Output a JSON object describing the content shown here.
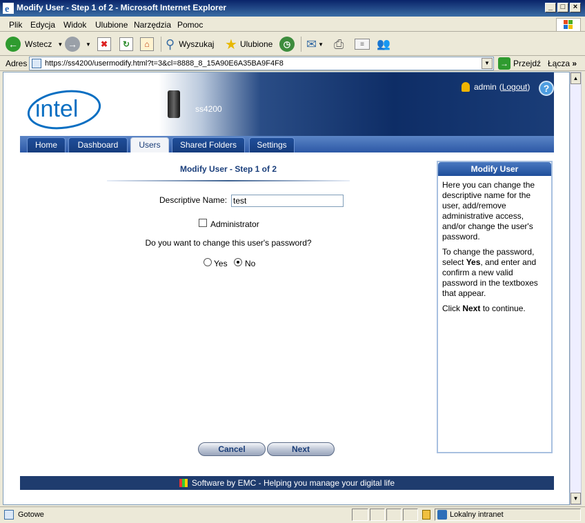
{
  "window": {
    "title": "Modify User - Step 1 of 2 - Microsoft Internet Explorer"
  },
  "menu": {
    "items": [
      "Plik",
      "Edycja",
      "Widok",
      "Ulubione",
      "Narzędzia",
      "Pomoc"
    ]
  },
  "toolbar": {
    "back": "Wstecz",
    "search": "Wyszukaj",
    "favorites": "Ulubione"
  },
  "address": {
    "label": "Adres",
    "url": "https://ss4200/usermodify.html?t=3&cl=8888_8_15A90E6A35BA9F4F8",
    "go": "Przejdź",
    "links": "Łącza"
  },
  "header": {
    "logo_text": "intel",
    "device": "ss4200",
    "user": "admin",
    "logout": "Logout"
  },
  "nav": {
    "tabs": [
      "Home",
      "Dashboard",
      "Users",
      "Shared Folders",
      "Settings"
    ],
    "active": "Users"
  },
  "form": {
    "title": "Modify User - Step 1 of 2",
    "name_label": "Descriptive Name:",
    "name_value": "test",
    "admin_label": "Administrator",
    "question": "Do you want to change this user's password?",
    "yes": "Yes",
    "no": "No",
    "selected": "No",
    "cancel": "Cancel",
    "next": "Next"
  },
  "help": {
    "title": "Modify User",
    "p1": "Here you can change the descriptive name for the user, add/remove administrative access, and/or change the user's password.",
    "p2_a": "To change the password, select ",
    "p2_b": "Yes",
    "p2_c": ", and enter and confirm a new valid password in the textboxes that appear.",
    "p3_a": "Click ",
    "p3_b": "Next",
    "p3_c": " to continue."
  },
  "footer": {
    "text": "Software by EMC - Helping you manage your digital life"
  },
  "status": {
    "text": "Gotowe",
    "zone": "Lokalny intranet"
  }
}
